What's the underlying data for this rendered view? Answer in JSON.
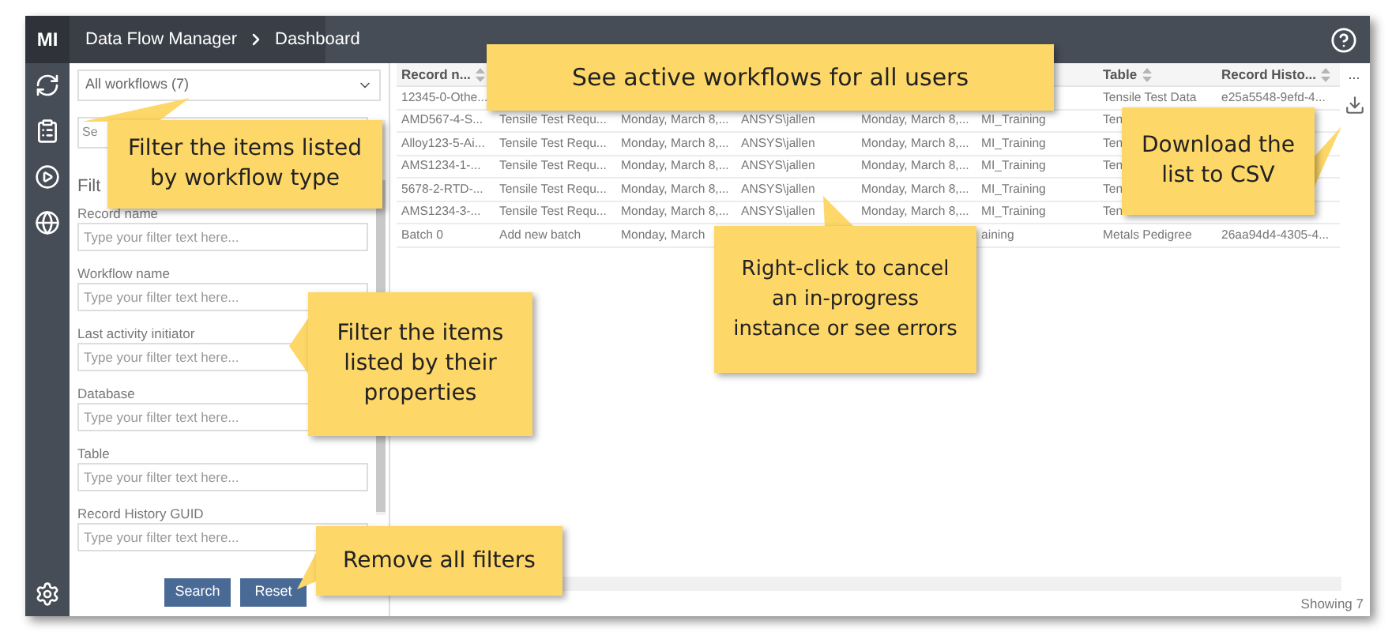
{
  "app": {
    "logo": "MI",
    "breadcrumb": [
      "Data Flow Manager",
      "Dashboard"
    ]
  },
  "filter_panel": {
    "workflow_select": "All workflows (7)",
    "search_placeholder": "Se",
    "heading": "Filt",
    "fields": [
      {
        "label": "Record name",
        "placeholder": "Type your filter text here..."
      },
      {
        "label": "Workflow name",
        "placeholder": "Type your filter text here..."
      },
      {
        "label": "Last activity initiator",
        "placeholder": "Type your filter text here..."
      },
      {
        "label": "Database",
        "placeholder": "Type your filter text here..."
      },
      {
        "label": "Table",
        "placeholder": "Type your filter text here..."
      },
      {
        "label": "Record History GUID",
        "placeholder": "Type your filter text here..."
      }
    ],
    "buttons": [
      "Search",
      "Reset"
    ]
  },
  "table": {
    "header": {
      "column_1": "Record n...",
      "column_7": "Table",
      "column_8": "Record Histo..."
    },
    "more": "...",
    "rows": [
      {
        "column_1": "12345-0-Othe...",
        "column_7": "Tensile Test Data",
        "column_8": "e25a5548-9efd-4..."
      },
      {
        "column_1": "AMD567-4-S...",
        "column_2": "Tensile Test Requ...",
        "column_3": "Monday, March 8,...",
        "column_4": "ANSYS\\jallen",
        "column_5": "Monday, March 8,...",
        "column_6": "MI_Training",
        "column_7": "Ten"
      },
      {
        "column_1": "Alloy123-5-Ai...",
        "column_2": "Tensile Test Requ...",
        "column_3": "Monday, March 8,...",
        "column_4": "ANSYS\\jallen",
        "column_5": "Monday, March 8,...",
        "column_6": "MI_Training",
        "column_7": "Ten"
      },
      {
        "column_1": "AMS1234-1-...",
        "column_2": "Tensile Test Requ...",
        "column_3": "Monday, March 8,...",
        "column_4": "ANSYS\\jallen",
        "column_5": "Monday, March 8,...",
        "column_6": "MI_Training",
        "column_7": "Ten"
      },
      {
        "column_1": "5678-2-RTD-...",
        "column_2": "Tensile Test Requ...",
        "column_3": "Monday, March 8,...",
        "column_4": "ANSYS\\jallen",
        "column_5": "Monday, March 8,...",
        "column_6": "MI_Training",
        "column_7": "Ten"
      },
      {
        "column_1": "AMS1234-3-...",
        "column_2": "Tensile Test Requ...",
        "column_3": "Monday, March 8,...",
        "column_4": "ANSYS\\jallen",
        "column_5": "Monday, March 8,...",
        "column_6": "MI_Training",
        "column_7": "Ten"
      },
      {
        "column_1": "Batch 0",
        "column_2": "Add new batch",
        "column_3": "Monday, March",
        "column_6": "aining",
        "column_7": "Metals Pedigree",
        "column_8": "26aa94d4-4305-4..."
      }
    ],
    "status": "Showing 7"
  },
  "callouts": [
    "See active workflows for all users",
    "Filter the items listed by workflow type",
    "Filter the items listed by their properties",
    "Remove all filters",
    "Right-click to cancel an in-progress instance or see errors",
    "Download the list to CSV"
  ]
}
